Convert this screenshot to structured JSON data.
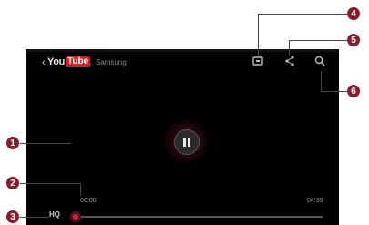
{
  "topbar": {
    "back_symbol": "‹",
    "logo_you": "You",
    "logo_tube": "Tube",
    "account": "Samsung",
    "icons": [
      "screen-mirror-icon",
      "share-icon",
      "search-icon"
    ]
  },
  "player": {
    "state": "playing",
    "current_time": "00:00",
    "total_time": "04:39",
    "quality_label": "HQ",
    "progress": 0.0
  },
  "callouts": {
    "c1": "1",
    "c2": "2",
    "c3": "3",
    "c4": "4",
    "c5": "5",
    "c6": "6"
  },
  "colors": {
    "accent": "#c42a36",
    "callout": "#8a1d2c",
    "background": "#000000"
  }
}
